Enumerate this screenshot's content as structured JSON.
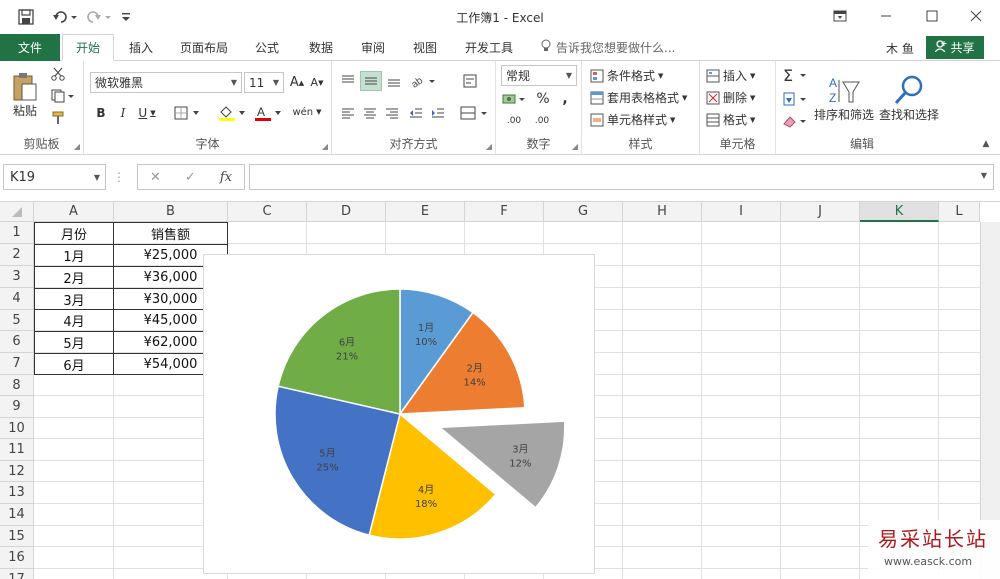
{
  "titlebar": {
    "title": "工作簿1 - Excel",
    "save_icon": "save-icon",
    "undo_icon": "undo-icon",
    "redo_icon": "redo-icon",
    "customize_icon": "customize-qat-icon"
  },
  "tabs": {
    "file": "文件",
    "items": [
      "开始",
      "插入",
      "页面布局",
      "公式",
      "数据",
      "审阅",
      "视图",
      "开发工具"
    ],
    "tell_me": "告诉我您想要做什么...",
    "user": "木 鱼",
    "share": "共享"
  },
  "ribbon": {
    "clipboard": {
      "paste": "粘贴",
      "label": "剪贴板"
    },
    "font": {
      "family": "微软雅黑",
      "size": "11",
      "label": "字体",
      "bold": "B",
      "italic": "I",
      "underline": "U",
      "grow": "A",
      "shrink": "A",
      "phonetic": "wén"
    },
    "alignment": {
      "label": "对齐方式"
    },
    "number": {
      "format": "常规",
      "label": "数字",
      "percent": "%",
      "comma": ",",
      "inc": ".00",
      "dec": ".00"
    },
    "styles": {
      "conditional": "条件格式",
      "table": "套用表格格式",
      "cell": "单元格样式",
      "label": "样式"
    },
    "cells": {
      "insert": "插入",
      "delete": "删除",
      "format": "格式",
      "label": "单元格"
    },
    "editing": {
      "sort": "排序和筛选",
      "find": "查找和选择",
      "label": "编辑"
    }
  },
  "formula_bar": {
    "name_box": "K19",
    "cancel": "✕",
    "enter": "✓",
    "fx": "fx",
    "value": ""
  },
  "sheet": {
    "columns": [
      "A",
      "B",
      "C",
      "D",
      "E",
      "F",
      "G",
      "H",
      "I",
      "J",
      "K",
      "L"
    ],
    "rows": [
      "1",
      "2",
      "3",
      "4",
      "5",
      "6",
      "7",
      "8",
      "9",
      "10",
      "11",
      "12",
      "13",
      "14",
      "15",
      "16",
      "17"
    ],
    "selected_column": "K",
    "header": [
      "月份",
      "销售额"
    ],
    "data": [
      [
        "1月",
        "¥25,000"
      ],
      [
        "2月",
        "¥36,000"
      ],
      [
        "3月",
        "¥30,000"
      ],
      [
        "4月",
        "¥45,000"
      ],
      [
        "5月",
        "¥62,000"
      ],
      [
        "6月",
        "¥54,000"
      ]
    ]
  },
  "chart_data": {
    "type": "pie",
    "categories": [
      "1月",
      "2月",
      "3月",
      "4月",
      "5月",
      "6月"
    ],
    "values": [
      25000,
      36000,
      30000,
      45000,
      62000,
      54000
    ],
    "percent_labels": [
      "10%",
      "14%",
      "12%",
      "18%",
      "25%",
      "21%"
    ],
    "colors": [
      "#5b9bd5",
      "#ed7d31",
      "#a5a5a5",
      "#ffc000",
      "#4472c4",
      "#70ad47"
    ],
    "exploded": [
      "3月"
    ],
    "legend": "none",
    "title": ""
  },
  "watermark": {
    "text": "易采站长站",
    "sub": "www.easck.com"
  }
}
